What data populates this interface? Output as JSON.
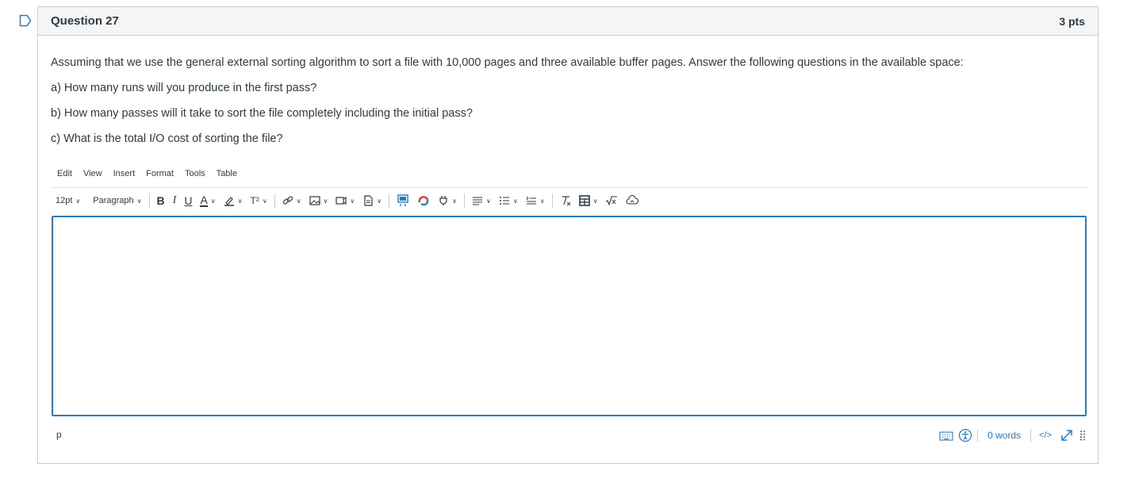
{
  "question": {
    "title": "Question 27",
    "points": "3 pts",
    "text": [
      "Assuming that we use the general external sorting algorithm to sort a file with 10,000 pages and three available buffer pages.  Answer the following questions in the available space:",
      "a) How many runs will you produce in the first pass?",
      "b) How many passes will it take to sort the file completely including the initial pass?",
      "c) What is the total I/O cost of sorting the file?"
    ]
  },
  "editor": {
    "menu": [
      "Edit",
      "View",
      "Insert",
      "Format",
      "Tools",
      "Table"
    ],
    "font_size": "12pt",
    "block_format": "Paragraph",
    "bold_label": "B",
    "italic_label": "I",
    "underline_label": "U",
    "text_color_label": "A",
    "superscript_label": "T²",
    "content": "",
    "element_path": "p",
    "word_count": "0 words",
    "html_toggle": "</>"
  },
  "colors": {
    "accent": "#2b7abc",
    "text": "#2d3b45",
    "border": "#c7cdd1"
  }
}
